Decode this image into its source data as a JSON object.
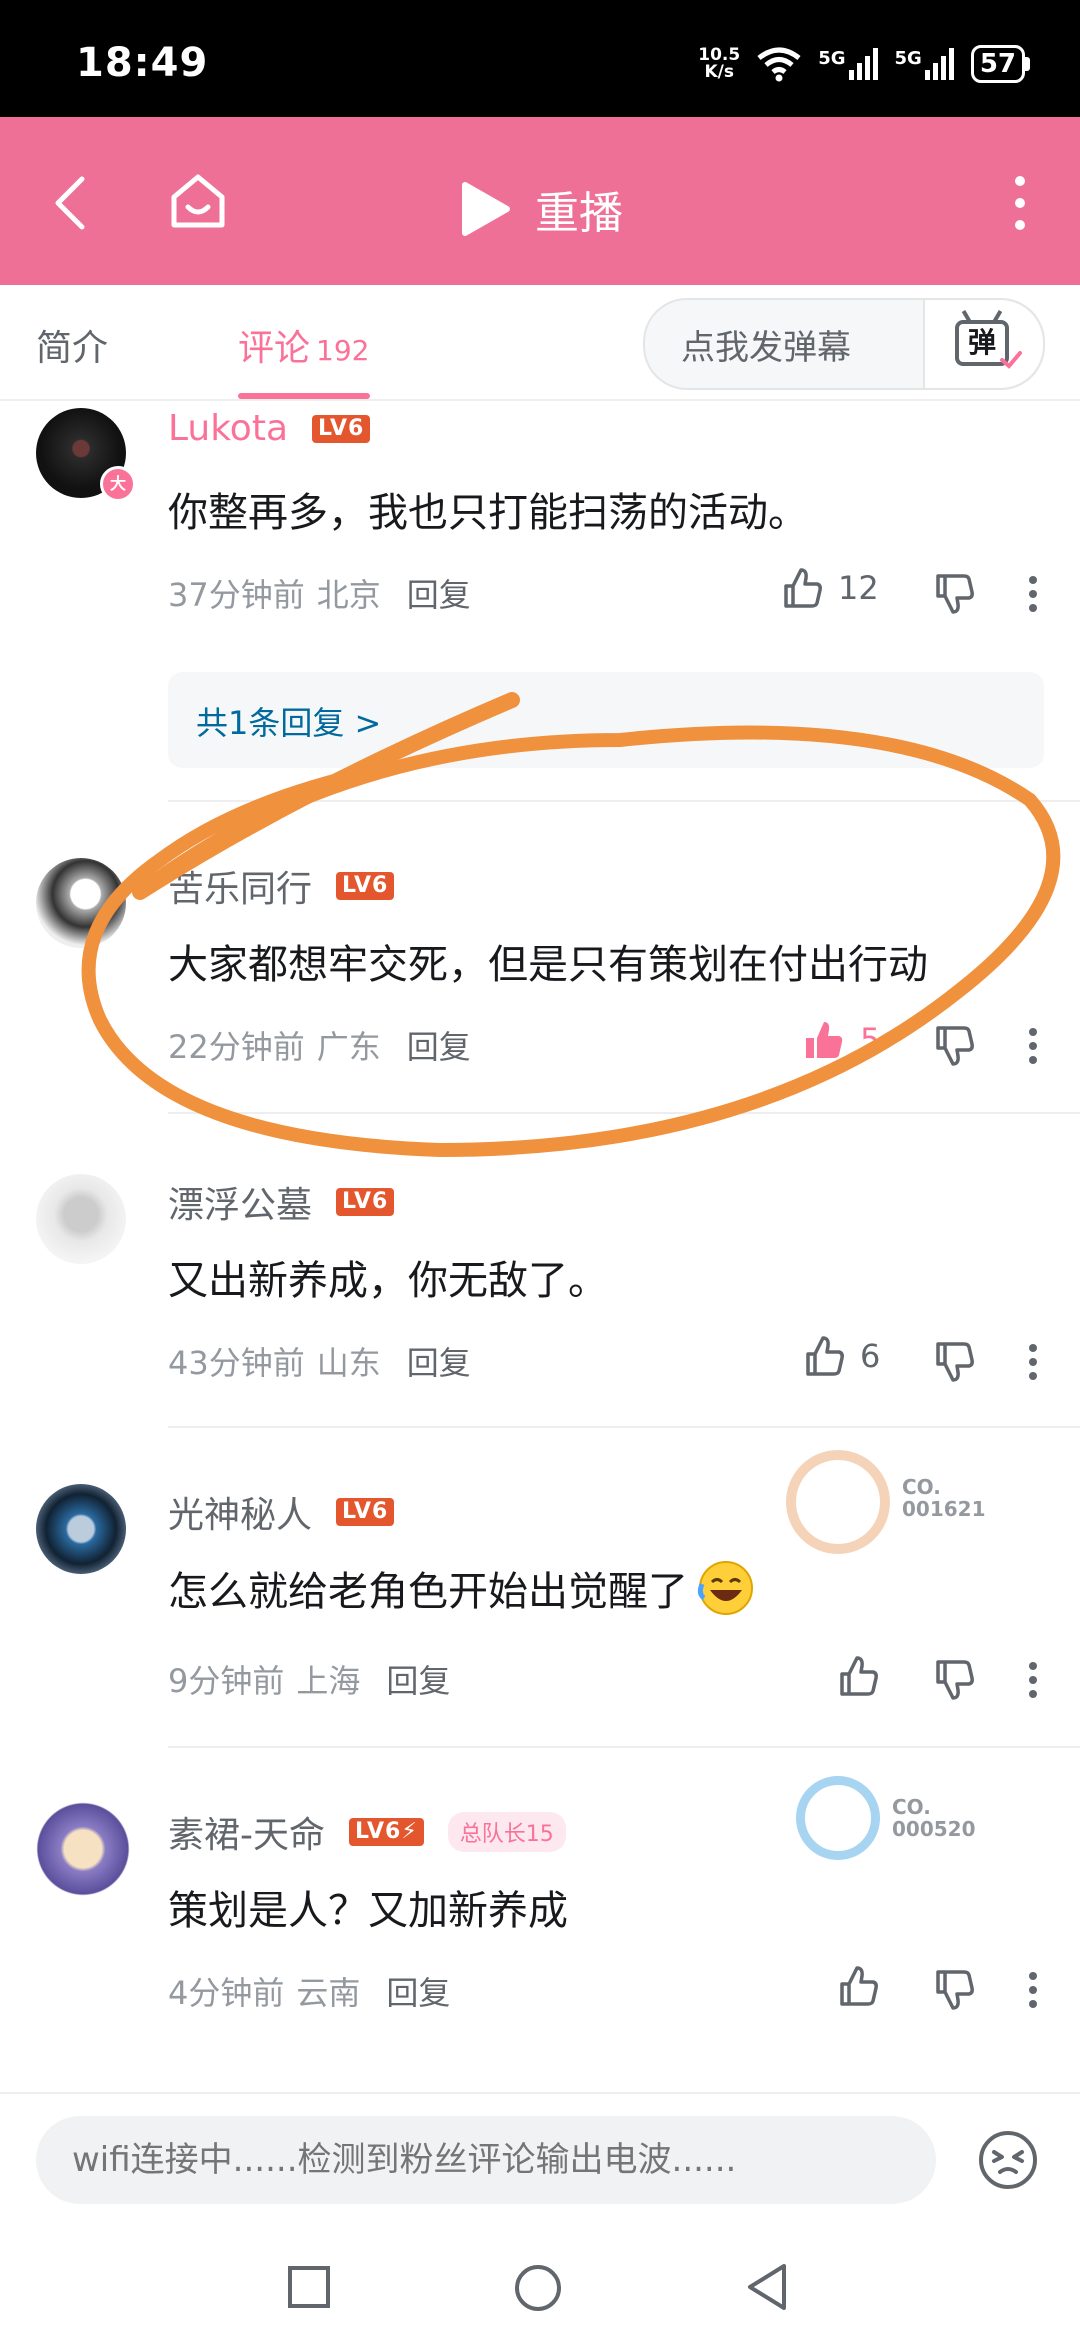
{
  "status": {
    "time": "18:49",
    "net_speed_top": "10.5",
    "net_speed_bottom": "K/s",
    "sim1": "5G",
    "sim2": "5G",
    "battery": "57"
  },
  "nav": {
    "replay_label": "重播"
  },
  "tabs": {
    "intro": "简介",
    "comments": "评论",
    "comment_count": "192"
  },
  "danmaku": {
    "placeholder": "点我发弹幕",
    "button_glyph": "弹"
  },
  "comments": [
    {
      "username": "Lukota",
      "level": "LV6",
      "text": "你整再多，我也只打能扫荡的活动。",
      "time": "37分钟前",
      "location": "北京",
      "reply": "回复",
      "likes": "12",
      "liked": false,
      "sub_replies": "共1条回复 >"
    },
    {
      "username": "苦乐同行",
      "level": "LV6",
      "text": "大家都想牢交死，但是只有策划在付出行动",
      "time": "22分钟前",
      "location": "广东",
      "reply": "回复",
      "likes": "5",
      "liked": true
    },
    {
      "username": "漂浮公墓",
      "level": "LV6",
      "text": "又出新养成，你无敌了。",
      "time": "43分钟前",
      "location": "山东",
      "reply": "回复",
      "likes": "6",
      "liked": false
    },
    {
      "username": "光神秘人",
      "level": "LV6",
      "text": "怎么就给老角色开始出觉醒了",
      "time": "9分钟前",
      "location": "上海",
      "reply": "回复",
      "likes": "",
      "liked": false,
      "code_label": "CO.",
      "code_number": "001621"
    },
    {
      "username": "素裙-天命",
      "level": "LV6⚡",
      "fan_badge": "总队长15",
      "text": "策划是人？又加新养成",
      "time": "4分钟前",
      "location": "云南",
      "reply": "回复",
      "likes": "",
      "liked": false,
      "code_label": "CO.",
      "code_number": "000520"
    }
  ],
  "input": {
    "placeholder": "wifi连接中......检测到粉丝评论输出电波......"
  },
  "colors": {
    "nav_pink": "#ef7097",
    "accent": "#fb7299",
    "annotation_orange": "#f0913e"
  }
}
